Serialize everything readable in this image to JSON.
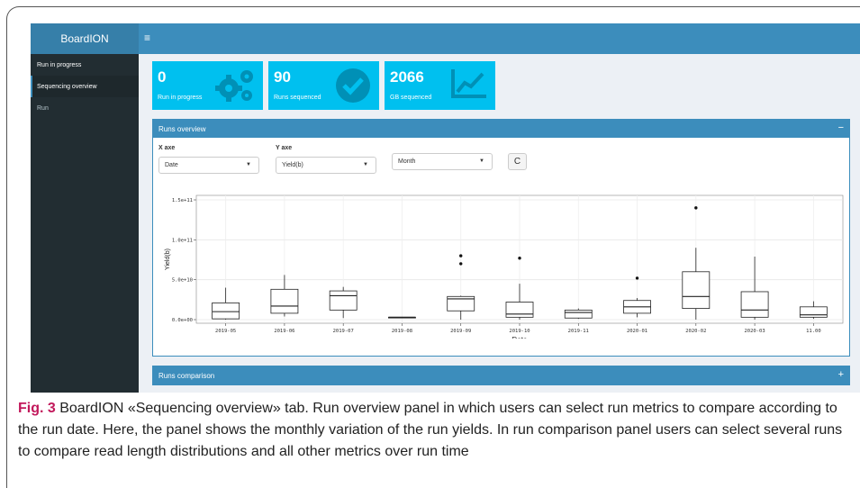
{
  "sidebar": {
    "brand": "BoardION",
    "items": [
      {
        "label": "Run in progress"
      },
      {
        "label": "Sequencing overview"
      },
      {
        "label": "Run"
      }
    ]
  },
  "topbar": {
    "menu_icon": "≡"
  },
  "stats": [
    {
      "value": "0",
      "label": "Run in progress",
      "icon": "gears-icon"
    },
    {
      "value": "90",
      "label": "Runs sequenced",
      "icon": "check-circle-icon"
    },
    {
      "value": "2066",
      "label": "GB sequenced",
      "icon": "area-chart-icon"
    }
  ],
  "runs_overview": {
    "title": "Runs overview",
    "collapse": "−",
    "x_label": "X axe",
    "y_label": "Y axe",
    "x_value": "Date",
    "y_value": "Yield(b)",
    "group_value": "Month",
    "refresh_icon": "C"
  },
  "runs_comparison": {
    "title": "Runs comparison",
    "expand": "+"
  },
  "caption": {
    "prefix": "Fig. 3",
    "text": "BoardION «Sequencing overview» tab. Run overview panel in which users can select run metrics to compare according to the run date. Here, the panel shows the monthly variation of the run yields. In run comparison panel users can select several runs to compare read length distributions and all other metrics over run time"
  },
  "colors": {
    "accent": "#3c8dbc",
    "info": "#00c0ef",
    "sidebar": "#222d32"
  },
  "chart_data": {
    "type": "boxplot",
    "xlabel": "Date",
    "ylabel": "Yield(b)",
    "ylim": [
      0,
      150000000000
    ],
    "yticks": [
      {
        "value": 0,
        "label": "0.0e+00"
      },
      {
        "value": 50000000000,
        "label": "5.0e+10"
      },
      {
        "value": 100000000000,
        "label": "1.0e+11"
      },
      {
        "value": 150000000000,
        "label": "1.5e+11"
      }
    ],
    "grid": true,
    "categories": [
      "2019-05",
      "2019-06",
      "2019-07",
      "2019-08",
      "2019-09",
      "2019-10",
      "2019-11",
      "2020-01",
      "2020-02",
      "2020-03",
      "11.00"
    ],
    "boxes": [
      {
        "min": 0.0,
        "q1": 0.1,
        "median": 1.0,
        "q3": 2.1,
        "max": 4.0,
        "outliers": []
      },
      {
        "min": 0.4,
        "q1": 0.8,
        "median": 1.7,
        "q3": 3.8,
        "max": 5.6,
        "outliers": []
      },
      {
        "min": 0.2,
        "q1": 1.2,
        "median": 3.0,
        "q3": 3.6,
        "max": 4.1,
        "outliers": []
      },
      {
        "min": 0.3,
        "q1": 0.3,
        "median": 0.3,
        "q3": 0.3,
        "max": 0.3,
        "outliers": []
      },
      {
        "min": 0.0,
        "q1": 1.1,
        "median": 2.6,
        "q3": 2.9,
        "max": 3.0,
        "outliers": [
          7.0,
          8.0
        ]
      },
      {
        "min": 0.0,
        "q1": 0.3,
        "median": 0.7,
        "q3": 2.2,
        "max": 4.5,
        "outliers": [
          7.7
        ]
      },
      {
        "min": 0.1,
        "q1": 0.2,
        "median": 0.9,
        "q3": 1.2,
        "max": 1.4,
        "outliers": []
      },
      {
        "min": 0.3,
        "q1": 0.8,
        "median": 1.6,
        "q3": 2.4,
        "max": 2.7,
        "outliers": [
          5.2
        ]
      },
      {
        "min": 0.0,
        "q1": 1.4,
        "median": 2.9,
        "q3": 6.0,
        "max": 9.0,
        "outliers": [
          14.0
        ]
      },
      {
        "min": 0.0,
        "q1": 0.3,
        "median": 1.2,
        "q3": 3.5,
        "max": 7.9,
        "outliers": []
      },
      {
        "min": 0.1,
        "q1": 0.3,
        "median": 0.6,
        "q3": 1.6,
        "max": 2.3,
        "outliers": []
      }
    ],
    "value_unit_multiplier": 10000000000
  }
}
